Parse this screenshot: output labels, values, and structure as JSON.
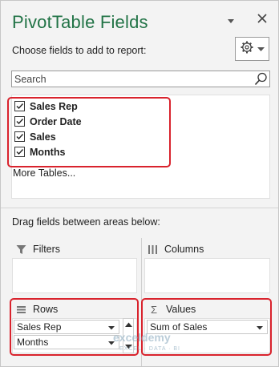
{
  "pane": {
    "title": "PivotTable Fields",
    "choose_label": "Choose fields to add to report:",
    "search_placeholder": "Search",
    "fields": [
      {
        "label": "Sales Rep",
        "checked": true
      },
      {
        "label": "Order Date",
        "checked": true
      },
      {
        "label": "Sales",
        "checked": true
      },
      {
        "label": "Months",
        "checked": true
      }
    ],
    "more_tables": "More Tables...",
    "drag_text": "Drag fields between areas below:"
  },
  "areas": {
    "filters": {
      "label": "Filters",
      "items": []
    },
    "columns": {
      "label": "Columns",
      "items": []
    },
    "rows": {
      "label": "Rows",
      "items": [
        "Sales Rep",
        "Months"
      ]
    },
    "values": {
      "label": "Values",
      "items": [
        "Sum of Sales"
      ]
    }
  },
  "watermark": {
    "text": "exceldemy",
    "sub": "EXCEL · DATA · BI"
  },
  "colors": {
    "title_green": "#217346",
    "highlight_red": "#d9232d"
  },
  "icons": {
    "pane_options": "chevron-down-icon",
    "close": "close-icon",
    "settings": "gear-icon",
    "search": "search-icon",
    "filters": "filter-icon",
    "columns": "columns-icon",
    "rows": "rows-icon",
    "values": "sigma-icon"
  }
}
